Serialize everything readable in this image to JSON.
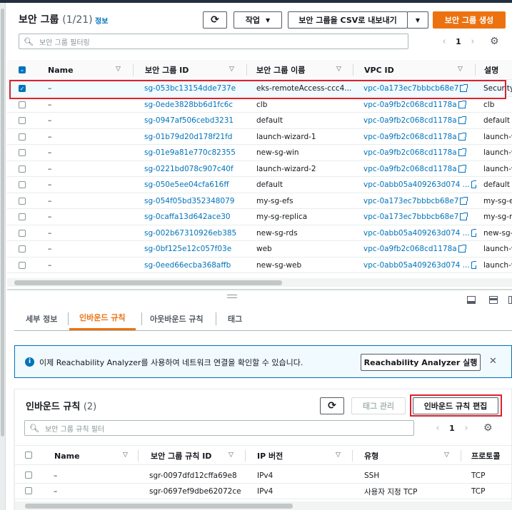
{
  "header": {
    "title": "보안 그룹",
    "count": "(1/21)",
    "info": "정보",
    "refresh_icon": "refresh-icon",
    "actions_label": "작업",
    "export_label": "보안 그룹을 CSV로 내보내기",
    "create_label": "보안 그룹 생성"
  },
  "filter": {
    "placeholder": "보안 그룹 필터링"
  },
  "pager": {
    "page": "1",
    "prev": "‹",
    "next": "›"
  },
  "table": {
    "columns": [
      "Name",
      "보안 그룹 ID",
      "보안 그룹 이름",
      "VPC ID",
      "설명"
    ],
    "rows": [
      {
        "name": "–",
        "id": "sg-053bc13154dde737e",
        "gname": "eks-remoteAccess-ccc4...",
        "vpc": "vpc-0a173ec7bbbcb68e7",
        "desc": "Security",
        "selected": true
      },
      {
        "name": "–",
        "id": "sg-0ede3828bb6d1fc6c",
        "gname": "clb",
        "vpc": "vpc-0a9fb2c068cd1178a",
        "desc": "clb"
      },
      {
        "name": "–",
        "id": "sg-0947af506cebd3231",
        "gname": "default",
        "vpc": "vpc-0a9fb2c068cd1178a",
        "desc": "default V"
      },
      {
        "name": "–",
        "id": "sg-01b79d20d178f21fd",
        "gname": "launch-wizard-1",
        "vpc": "vpc-0a9fb2c068cd1178a",
        "desc": "launch-w"
      },
      {
        "name": "–",
        "id": "sg-01e9a81e770c82355",
        "gname": "new-sg-win",
        "vpc": "vpc-0a9fb2c068cd1178a",
        "desc": "launch-w"
      },
      {
        "name": "–",
        "id": "sg-0221bd078c907c40f",
        "gname": "launch-wizard-2",
        "vpc": "vpc-0a9fb2c068cd1178a",
        "desc": "launch-w"
      },
      {
        "name": "–",
        "id": "sg-050e5ee04cfa616ff",
        "gname": "default",
        "vpc": "vpc-0abb05a409263d074 ...",
        "desc": "default V"
      },
      {
        "name": "–",
        "id": "sg-054f05bd352348079",
        "gname": "my-sg-efs",
        "vpc": "vpc-0a173ec7bbbcb68e7",
        "desc": "my-sg-e"
      },
      {
        "name": "–",
        "id": "sg-0caffa13d642ace30",
        "gname": "my-sg-replica",
        "vpc": "vpc-0a173ec7bbbcb68e7",
        "desc": "my-sg-re"
      },
      {
        "name": "–",
        "id": "sg-002b67310926eb385",
        "gname": "new-sg-rds",
        "vpc": "vpc-0abb05a409263d074 ...",
        "desc": "new-sg-"
      },
      {
        "name": "–",
        "id": "sg-0bf125e12c057f03e",
        "gname": "web",
        "vpc": "vpc-0a9fb2c068cd1178a",
        "desc": "launch-w"
      },
      {
        "name": "–",
        "id": "sg-0eed66ecba368affb",
        "gname": "new-sg-web",
        "vpc": "vpc-0abb05a409263d074 ...",
        "desc": "launch-w"
      }
    ]
  },
  "tabs": [
    {
      "label": "세부 정보"
    },
    {
      "label": "인바운드 규칙",
      "active": true
    },
    {
      "label": "아웃바운드 규칙"
    },
    {
      "label": "태그"
    }
  ],
  "alert": {
    "text": "이제 Reachability Analyzer를 사용하여 네트워크 연결을 확인할 수 있습니다.",
    "button": "Reachability Analyzer 실행",
    "close": "✕"
  },
  "inbound": {
    "title": "인바운드 규칙",
    "count": "(2)",
    "manage_tags": "태그 관리",
    "edit_label": "인바운드 규칙 편집",
    "filter_placeholder": "보안 그룹 규칙 필터",
    "page": "1",
    "columns": [
      "Name",
      "보안 그룹 규칙 ID",
      "IP 버전",
      "유형",
      "프로토콜"
    ],
    "rows": [
      {
        "name": "–",
        "id": "sgr-0097dfd12cffa69e8",
        "ip": "IPv4",
        "type": "SSH",
        "proto": "TCP"
      },
      {
        "name": "–",
        "id": "sgr-0697ef9dbe62072ce",
        "ip": "IPv4",
        "type": "사용자 지정 TCP",
        "proto": "TCP"
      }
    ]
  },
  "colors": {
    "accent": "#ec7211",
    "link": "#0073bb",
    "highlight": "#d9232e"
  }
}
